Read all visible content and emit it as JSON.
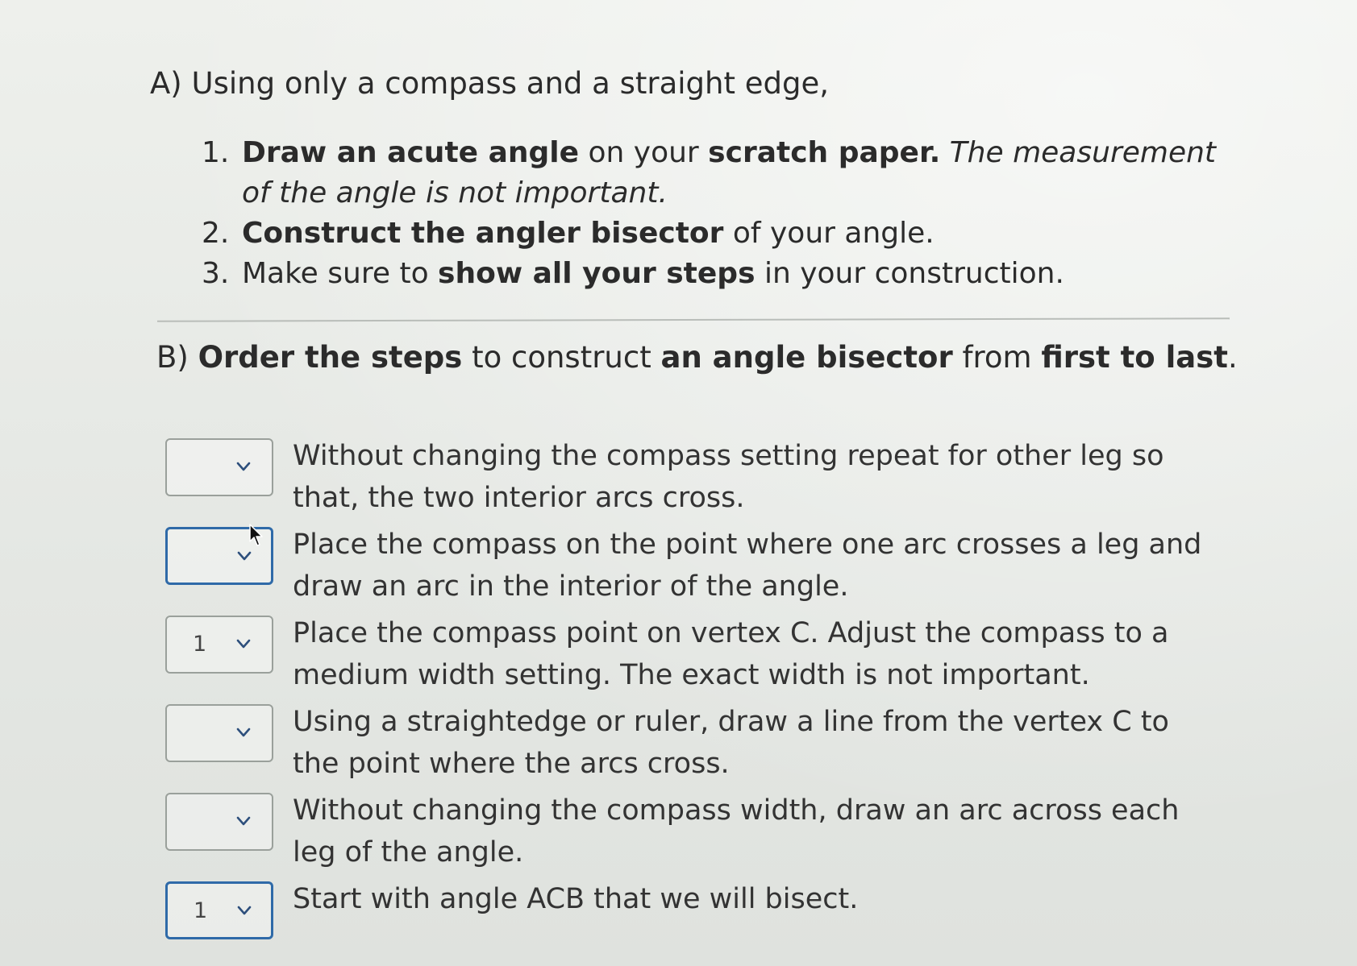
{
  "part_a": {
    "heading": "A) Using only a compass and a straight edge,",
    "items": [
      {
        "num": "1.",
        "line1": [
          {
            "text": "Draw an acute angle",
            "style": "b"
          },
          {
            "text": " on your ",
            "style": ""
          },
          {
            "text": "scratch paper.",
            "style": "b"
          },
          {
            "text": " The measurement",
            "style": "i"
          }
        ],
        "line2": [
          {
            "text": "of the angle is not important.",
            "style": "i"
          }
        ]
      },
      {
        "num": "2.",
        "line1": [
          {
            "text": "Construct the angler bisector",
            "style": "b"
          },
          {
            "text": " of your angle.",
            "style": ""
          }
        ]
      },
      {
        "num": "3.",
        "line1": [
          {
            "text": "Make sure to ",
            "style": ""
          },
          {
            "text": "show all your steps",
            "style": "b"
          },
          {
            "text": " in your construction.",
            "style": ""
          }
        ]
      }
    ]
  },
  "part_b": {
    "heading": [
      {
        "text": "B) ",
        "style": ""
      },
      {
        "text": "Order the steps",
        "style": "b"
      },
      {
        "text": " to construct ",
        "style": ""
      },
      {
        "text": "an angle bisector",
        "style": "b"
      },
      {
        "text": " from ",
        "style": ""
      },
      {
        "text": "first to last",
        "style": "b"
      },
      {
        "text": ".",
        "style": ""
      }
    ],
    "steps": [
      {
        "selected": "",
        "line1": "Without changing the compass setting repeat for other leg so",
        "line2": "that, the two interior arcs cross."
      },
      {
        "selected": "",
        "line1": "Place the compass on the point where one arc crosses a leg and",
        "line2": "draw an arc in the interior of the angle."
      },
      {
        "selected": "1",
        "line1": "Place the compass point on vertex C. Adjust the compass to a",
        "line2": "medium width setting. The exact width is not important."
      },
      {
        "selected": "",
        "line1": "Using a straightedge or ruler, draw a line from the vertex C to",
        "line2": "the point where the arcs cross."
      },
      {
        "selected": "",
        "line1": "Without changing the compass width, draw an arc across each",
        "line2": "leg of the angle."
      },
      {
        "selected": "1",
        "line1": "Start with angle ACB that we will bisect.",
        "line2": ""
      }
    ]
  },
  "colors": {
    "text": "#2b2b2b",
    "select_border": "#9aa09b",
    "focus_border": "#2f6aa8",
    "chevron": "#2d4f7c"
  }
}
